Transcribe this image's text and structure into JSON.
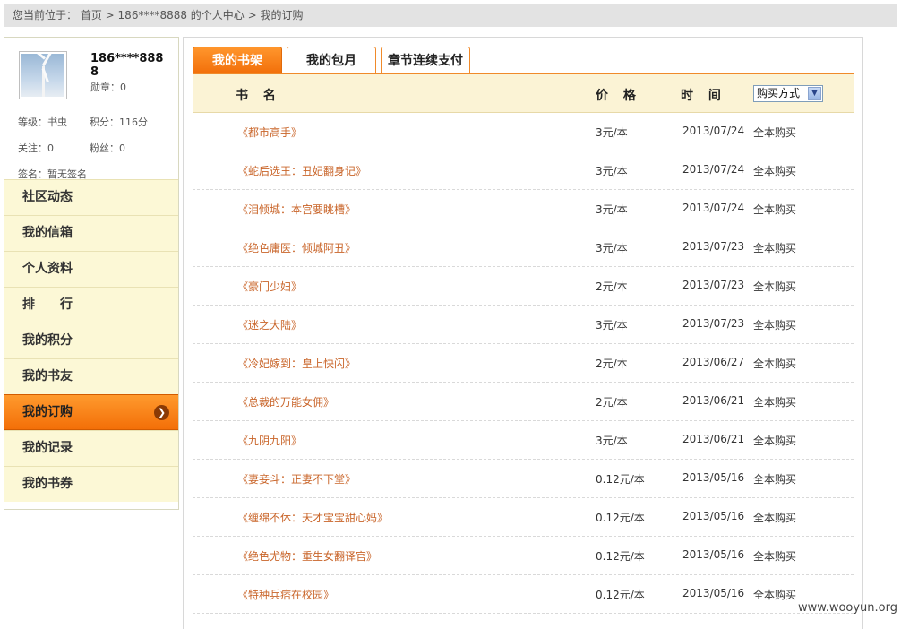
{
  "breadcrumb": {
    "prefix": "您当前位于：",
    "home": "首页",
    "sep1": " > ",
    "user_center": "186****8888 的个人中心",
    "sep2": " > ",
    "current": "我的订购"
  },
  "profile": {
    "username": "186****8888",
    "medal": "勋章：0",
    "level": "等级：书虫",
    "points": "积分：116分",
    "follow": "关注：0",
    "fans": "粉丝：0",
    "signature": "签名：暂无签名"
  },
  "menu": [
    {
      "label": "社区动态",
      "active": false
    },
    {
      "label": "我的信箱",
      "active": false
    },
    {
      "label": "个人资料",
      "active": false
    },
    {
      "label": "排　　行",
      "active": false
    },
    {
      "label": "我的积分",
      "active": false
    },
    {
      "label": "我的书友",
      "active": false
    },
    {
      "label": "我的订购",
      "active": true
    },
    {
      "label": "我的记录",
      "active": false
    },
    {
      "label": "我的书券",
      "active": false
    }
  ],
  "tabs": [
    {
      "label": "我的书架",
      "active": true
    },
    {
      "label": "我的包月",
      "active": false
    },
    {
      "label": "章节连续支付",
      "active": false
    }
  ],
  "table": {
    "headers": {
      "name": "书 名",
      "price": "价 格",
      "time": "时 间"
    },
    "purchase_select": "购买方式",
    "rows": [
      {
        "name": "《都市高手》",
        "price": "3元/本",
        "time": "2013/07/24",
        "mode": "全本购买"
      },
      {
        "name": "《蛇后选王：丑妃翻身记》",
        "price": "3元/本",
        "time": "2013/07/24",
        "mode": "全本购买"
      },
      {
        "name": "《泪倾城：本宫要眺槽》",
        "price": "3元/本",
        "time": "2013/07/24",
        "mode": "全本购买"
      },
      {
        "name": "《绝色庸医：倾城阿丑》",
        "price": "3元/本",
        "time": "2013/07/23",
        "mode": "全本购买"
      },
      {
        "name": "《豪门少妇》",
        "price": "2元/本",
        "time": "2013/07/23",
        "mode": "全本购买"
      },
      {
        "name": "《迷之大陆》",
        "price": "3元/本",
        "time": "2013/07/23",
        "mode": "全本购买"
      },
      {
        "name": "《冷妃嫁到：皇上快闪》",
        "price": "2元/本",
        "time": "2013/06/27",
        "mode": "全本购买"
      },
      {
        "name": "《总裁的万能女佣》",
        "price": "2元/本",
        "time": "2013/06/21",
        "mode": "全本购买"
      },
      {
        "name": "《九阴九阳》",
        "price": "3元/本",
        "time": "2013/06/21",
        "mode": "全本购买"
      },
      {
        "name": "《妻妾斗：正妻不下堂》",
        "price": "0.12元/本",
        "time": "2013/05/16",
        "mode": "全本购买"
      },
      {
        "name": "《缠绵不休：天才宝宝甜心妈》",
        "price": "0.12元/本",
        "time": "2013/05/16",
        "mode": "全本购买"
      },
      {
        "name": "《绝色尤物：重生女翻译官》",
        "price": "0.12元/本",
        "time": "2013/05/16",
        "mode": "全本购买"
      },
      {
        "name": "《特种兵痞在校园》",
        "price": "0.12元/本",
        "time": "2013/05/16",
        "mode": "全本购买"
      }
    ]
  },
  "watermark": "www.wooyun.org"
}
